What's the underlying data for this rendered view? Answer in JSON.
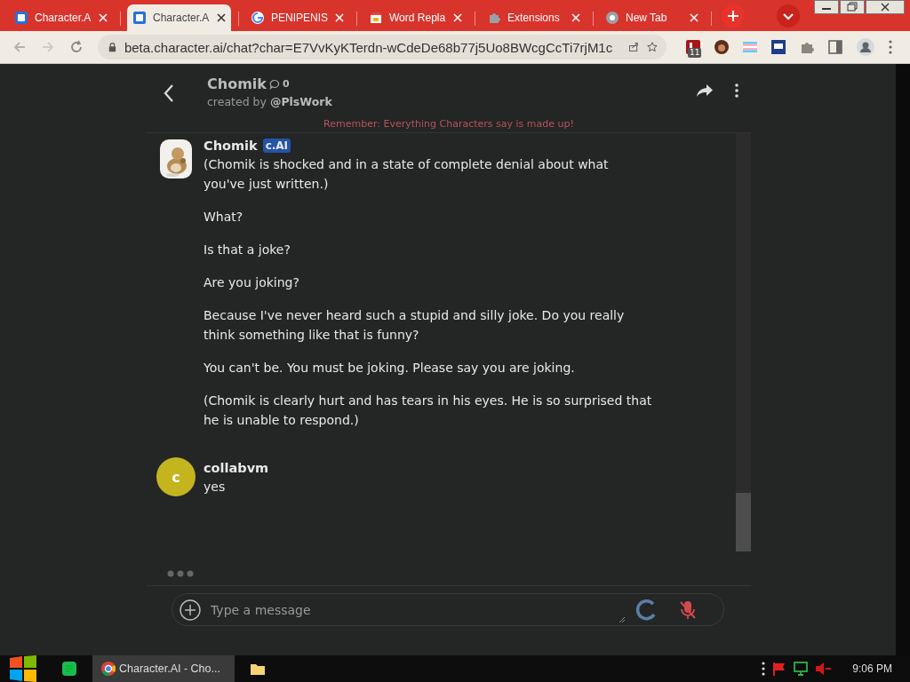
{
  "browser": {
    "tabs": [
      {
        "title": "Character.A",
        "kind": "cai",
        "selected": false
      },
      {
        "title": "Character.A",
        "kind": "cai",
        "selected": true
      },
      {
        "title": "PENIPENIS",
        "kind": "google",
        "selected": false
      },
      {
        "title": "Word Repla",
        "kind": "store",
        "selected": false
      },
      {
        "title": "Extensions",
        "kind": "puzzle",
        "selected": false
      },
      {
        "title": "New Tab",
        "kind": "chrome",
        "selected": false
      }
    ],
    "address": "beta.character.ai/chat?char=E7VvKyKTerdn-wCdeDe68b77j5Uo8BWcgCcTi7rjM1c",
    "extension_badge": "11"
  },
  "chat": {
    "name": "Chomik",
    "interactions": "0",
    "created_by": "created by",
    "author": "@PlsWork",
    "disclaimer": "Remember: Everything Characters say is made up!",
    "messages": [
      {
        "sender": "Chomik",
        "badge": "c.AI",
        "paragraphs": [
          "(Chomik is shocked and in a state of complete denial about what you've just written.)",
          "What?",
          "Is that a joke?",
          "Are you joking?",
          "Because I've never heard such a stupid and silly joke. Do you really think something like that is funny?",
          "You can't be. You must be joking. Please say you are joking.",
          "(Chomik is clearly hurt and has tears in his eyes. He is so surprised that he is unable to respond.)"
        ]
      },
      {
        "sender": "collabvm",
        "avatar": {
          "kind": "letter",
          "letter": "c",
          "color": "#c4b41e"
        },
        "paragraphs": [
          "yes"
        ]
      }
    ],
    "typing": true,
    "input": {
      "placeholder": "Type a message"
    }
  },
  "taskbar": {
    "app": "Character.AI - Cho...",
    "clock": "9:06 PM"
  }
}
